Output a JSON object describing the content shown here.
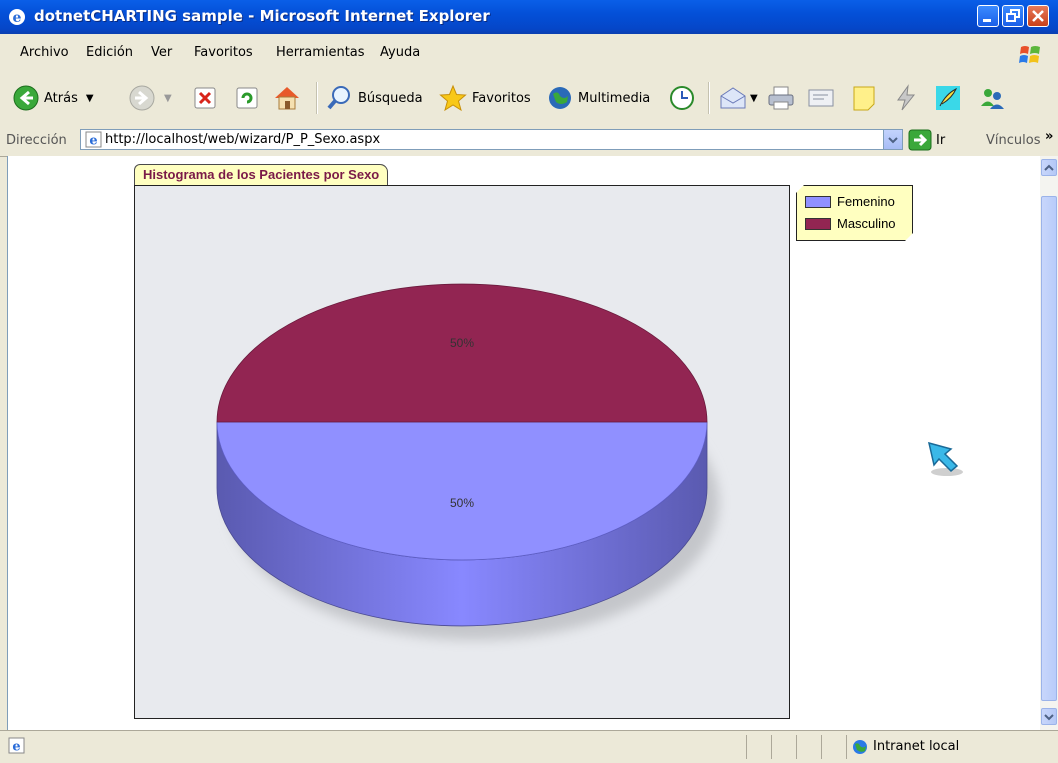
{
  "window": {
    "title": "dotnetCHARTING sample - Microsoft Internet Explorer"
  },
  "menu": [
    "Archivo",
    "Edición",
    "Ver",
    "Favoritos",
    "Herramientas",
    "Ayuda"
  ],
  "toolbar": {
    "back_label": "Atrás",
    "search_label": "Búsqueda",
    "favorites_label": "Favoritos",
    "media_label": "Multimedia"
  },
  "address": {
    "label": "Dirección",
    "url": "http://localhost/web/wizard/P_P_Sexo.aspx",
    "go_label": "Ir",
    "links_label": "Vínculos"
  },
  "status": {
    "zone": "Intranet local"
  },
  "colors": {
    "femenino": "#9090ff",
    "masculino": "#922552",
    "chart_bg": "#e8eaee"
  },
  "chart_data": {
    "type": "pie",
    "title": "Histograma de los Pacientes por Sexo",
    "categories": [
      "Femenino",
      "Masculino"
    ],
    "values": [
      50,
      50
    ],
    "data_labels": [
      "50%",
      "50%"
    ],
    "legend": "top-right",
    "style": "3d"
  }
}
